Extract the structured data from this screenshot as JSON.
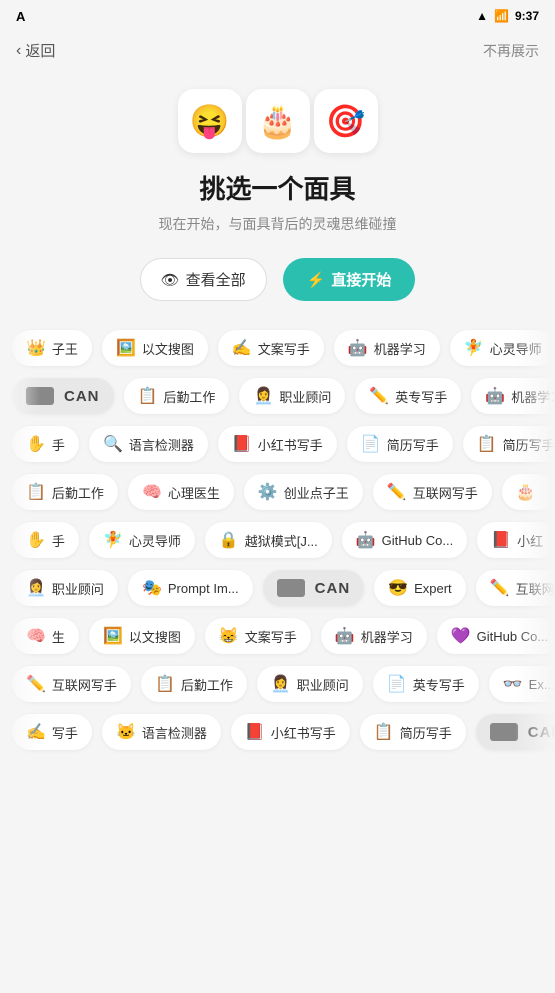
{
  "statusBar": {
    "appIcon": "A",
    "wifiIcon": "wifi",
    "signalIcon": "signal",
    "batteryIcon": "battery",
    "time": "9:37"
  },
  "nav": {
    "backLabel": "返回",
    "dismissLabel": "不再展示"
  },
  "hero": {
    "emojis": [
      "😝",
      "🎂",
      "🎯"
    ],
    "title": "挑选一个面具",
    "subtitle": "现在开始，与面具背后的灵魂思维碰撞",
    "btnViewAll": "查看全部",
    "btnStart": "直接开始"
  },
  "rows": [
    [
      {
        "icon": "👑",
        "label": "子王"
      },
      {
        "icon": "🖼️",
        "label": "以文搜图"
      },
      {
        "icon": "✍️",
        "label": "文案写手"
      },
      {
        "icon": "🤖",
        "label": "机器学习"
      },
      {
        "icon": "🧚",
        "label": "心灵导师"
      }
    ],
    [
      {
        "icon": "",
        "label": "CAN",
        "isCan": true
      },
      {
        "icon": "📋",
        "label": "后勤工作"
      },
      {
        "icon": "👩‍💼",
        "label": "职业顾问"
      },
      {
        "icon": "✏️",
        "label": "英专写手"
      },
      {
        "icon": "🤖",
        "label": "机器学习"
      }
    ],
    [
      {
        "icon": "✋",
        "label": "手"
      },
      {
        "icon": "🔍",
        "label": "语言检测器"
      },
      {
        "icon": "📕",
        "label": "小红书写手"
      },
      {
        "icon": "📄",
        "label": "简历写手"
      },
      {
        "icon": "📋",
        "label": "简历写手"
      }
    ],
    [
      {
        "icon": "📋",
        "label": "后勤工作"
      },
      {
        "icon": "🧠",
        "label": "心理医生"
      },
      {
        "icon": "⚙️",
        "label": "创业点子王"
      },
      {
        "icon": "✏️",
        "label": "互联网写手"
      },
      {
        "icon": "🎂",
        "label": ""
      }
    ],
    [
      {
        "icon": "✋",
        "label": "手"
      },
      {
        "icon": "🧚",
        "label": "心灵导师"
      },
      {
        "icon": "🔒",
        "label": "越狱模式[J..."
      },
      {
        "icon": "🤖",
        "label": "GitHub Co..."
      },
      {
        "icon": "📕",
        "label": "小红"
      }
    ],
    [
      {
        "icon": "👩‍💼",
        "label": "职业顾问"
      },
      {
        "icon": "🎭",
        "label": "Prompt Im..."
      },
      {
        "icon": "",
        "label": "CAN",
        "isCan": true
      },
      {
        "icon": "😎",
        "label": "Expert"
      },
      {
        "icon": "✏️",
        "label": "互联网"
      }
    ],
    [
      {
        "icon": "🧠",
        "label": "生"
      },
      {
        "icon": "🖼️",
        "label": "以文搜图"
      },
      {
        "icon": "😸",
        "label": "文案写手"
      },
      {
        "icon": "🤖",
        "label": "机器学习"
      },
      {
        "icon": "💜",
        "label": "GitHub Co..."
      }
    ],
    [
      {
        "icon": "✏️",
        "label": "互联网写手"
      },
      {
        "icon": "📋",
        "label": "后勤工作"
      },
      {
        "icon": "👩‍💼",
        "label": "职业顾问"
      },
      {
        "icon": "📄",
        "label": "英专写手"
      },
      {
        "icon": "👓",
        "label": "Ex..."
      }
    ],
    [
      {
        "icon": "✍️",
        "label": "写手"
      },
      {
        "icon": "🐱",
        "label": "语言检测器"
      },
      {
        "icon": "📕",
        "label": "小红书写手"
      },
      {
        "icon": "📋",
        "label": "简历写手"
      },
      {
        "icon": "",
        "label": "CAN",
        "isCan": true
      }
    ]
  ]
}
